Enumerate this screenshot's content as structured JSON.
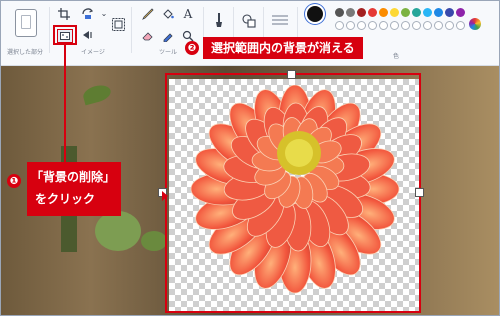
{
  "ribbon": {
    "selection_label": "選択した部分",
    "image_label": "イメージ",
    "tools_label": "ツール",
    "colors_label": "色",
    "text_tool_glyph": "A",
    "icons": [
      "selection-card-icon",
      "crop-icon",
      "rotate-icon",
      "remove-background-icon",
      "resize-icon",
      "image-select-icon",
      "pencil-icon",
      "fill-icon",
      "text-icon",
      "eraser-icon",
      "color-picker-icon",
      "magnifier-icon",
      "brush-icon",
      "shapes-icon",
      "line-width-icon",
      "edit-colors-icon"
    ],
    "palette_row1": [
      "#555555",
      "#7a7a7a",
      "#a32020",
      "#e53935",
      "#fb8c00",
      "#fdd835",
      "#7cb342",
      "#26a69a",
      "#29b6f6",
      "#1e88e5",
      "#3949ab",
      "#8e24aa"
    ],
    "palette_row2_outlined": 12,
    "selected_color": "#111111"
  },
  "annotations": {
    "step1": {
      "number": "❶",
      "line1": "「背景の削除」",
      "line2": "をクリック"
    },
    "step2": {
      "number": "❷",
      "text": "選択範囲内の背景が消える"
    },
    "accent_color": "#d7000f"
  },
  "canvas": {
    "subject": "dahlia",
    "transparency": "checkerboard"
  }
}
